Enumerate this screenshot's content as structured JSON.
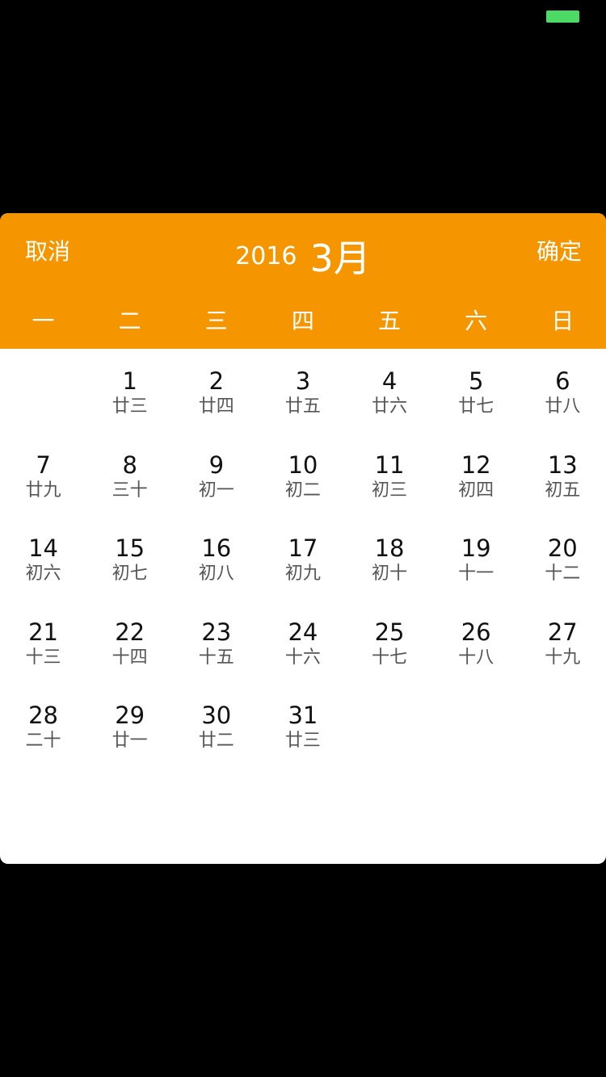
{
  "status_bar": {
    "battery_color": "#4cd964"
  },
  "picker": {
    "cancel_label": "取消",
    "confirm_label": "确定",
    "year": "2016",
    "month": "3月",
    "accent_color": "#f59600",
    "weekdays": [
      "一",
      "二",
      "三",
      "四",
      "五",
      "六",
      "日"
    ],
    "days": [
      {
        "day": "",
        "lunar": ""
      },
      {
        "day": "1",
        "lunar": "廿三"
      },
      {
        "day": "2",
        "lunar": "廿四"
      },
      {
        "day": "3",
        "lunar": "廿五"
      },
      {
        "day": "4",
        "lunar": "廿六"
      },
      {
        "day": "5",
        "lunar": "廿七"
      },
      {
        "day": "6",
        "lunar": "廿八"
      },
      {
        "day": "7",
        "lunar": "廿九"
      },
      {
        "day": "8",
        "lunar": "三十"
      },
      {
        "day": "9",
        "lunar": "初一"
      },
      {
        "day": "10",
        "lunar": "初二"
      },
      {
        "day": "11",
        "lunar": "初三"
      },
      {
        "day": "12",
        "lunar": "初四"
      },
      {
        "day": "13",
        "lunar": "初五"
      },
      {
        "day": "14",
        "lunar": "初六"
      },
      {
        "day": "15",
        "lunar": "初七"
      },
      {
        "day": "16",
        "lunar": "初八"
      },
      {
        "day": "17",
        "lunar": "初九"
      },
      {
        "day": "18",
        "lunar": "初十"
      },
      {
        "day": "19",
        "lunar": "十一"
      },
      {
        "day": "20",
        "lunar": "十二"
      },
      {
        "day": "21",
        "lunar": "十三"
      },
      {
        "day": "22",
        "lunar": "十四"
      },
      {
        "day": "23",
        "lunar": "十五"
      },
      {
        "day": "24",
        "lunar": "十六"
      },
      {
        "day": "25",
        "lunar": "十七"
      },
      {
        "day": "26",
        "lunar": "十八"
      },
      {
        "day": "27",
        "lunar": "十九"
      },
      {
        "day": "28",
        "lunar": "二十"
      },
      {
        "day": "29",
        "lunar": "廿一"
      },
      {
        "day": "30",
        "lunar": "廿二"
      },
      {
        "day": "31",
        "lunar": "廿三"
      }
    ]
  }
}
